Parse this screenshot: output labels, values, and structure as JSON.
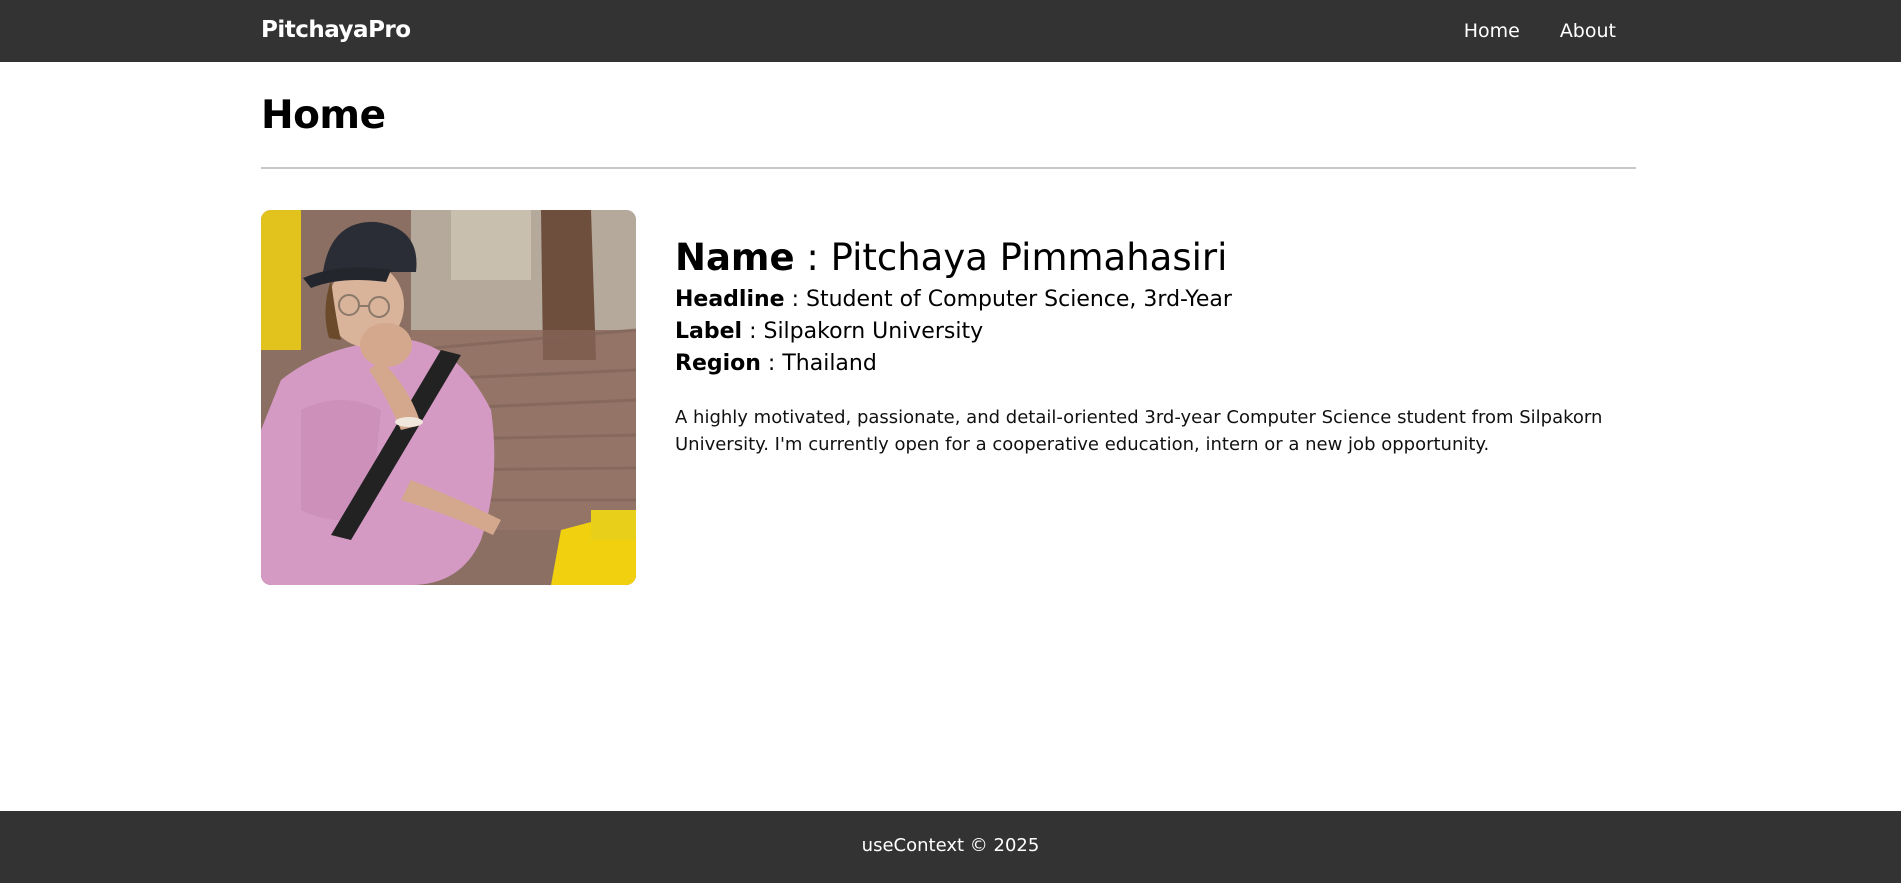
{
  "navbar": {
    "brand": "PitchayaPro",
    "links": [
      {
        "label": "Home"
      },
      {
        "label": "About"
      }
    ]
  },
  "page": {
    "title": "Home"
  },
  "profile": {
    "photo_alt": "Profile photo",
    "name_label": "Name",
    "name_value": "Pitchaya Pimmahasiri",
    "headline_label": "Headline",
    "headline_value": "Student of Computer Science, 3rd-Year",
    "label_label": "Label",
    "label_value": "Silpakorn University",
    "region_label": "Region",
    "region_value": "Thailand",
    "separator": " : ",
    "bio": "A highly motivated, passionate, and detail-oriented 3rd-year Computer Science student from Silpakorn University. I'm currently open for a cooperative education, intern or a new job opportunity."
  },
  "footer": {
    "text": "useContext © 2025"
  }
}
